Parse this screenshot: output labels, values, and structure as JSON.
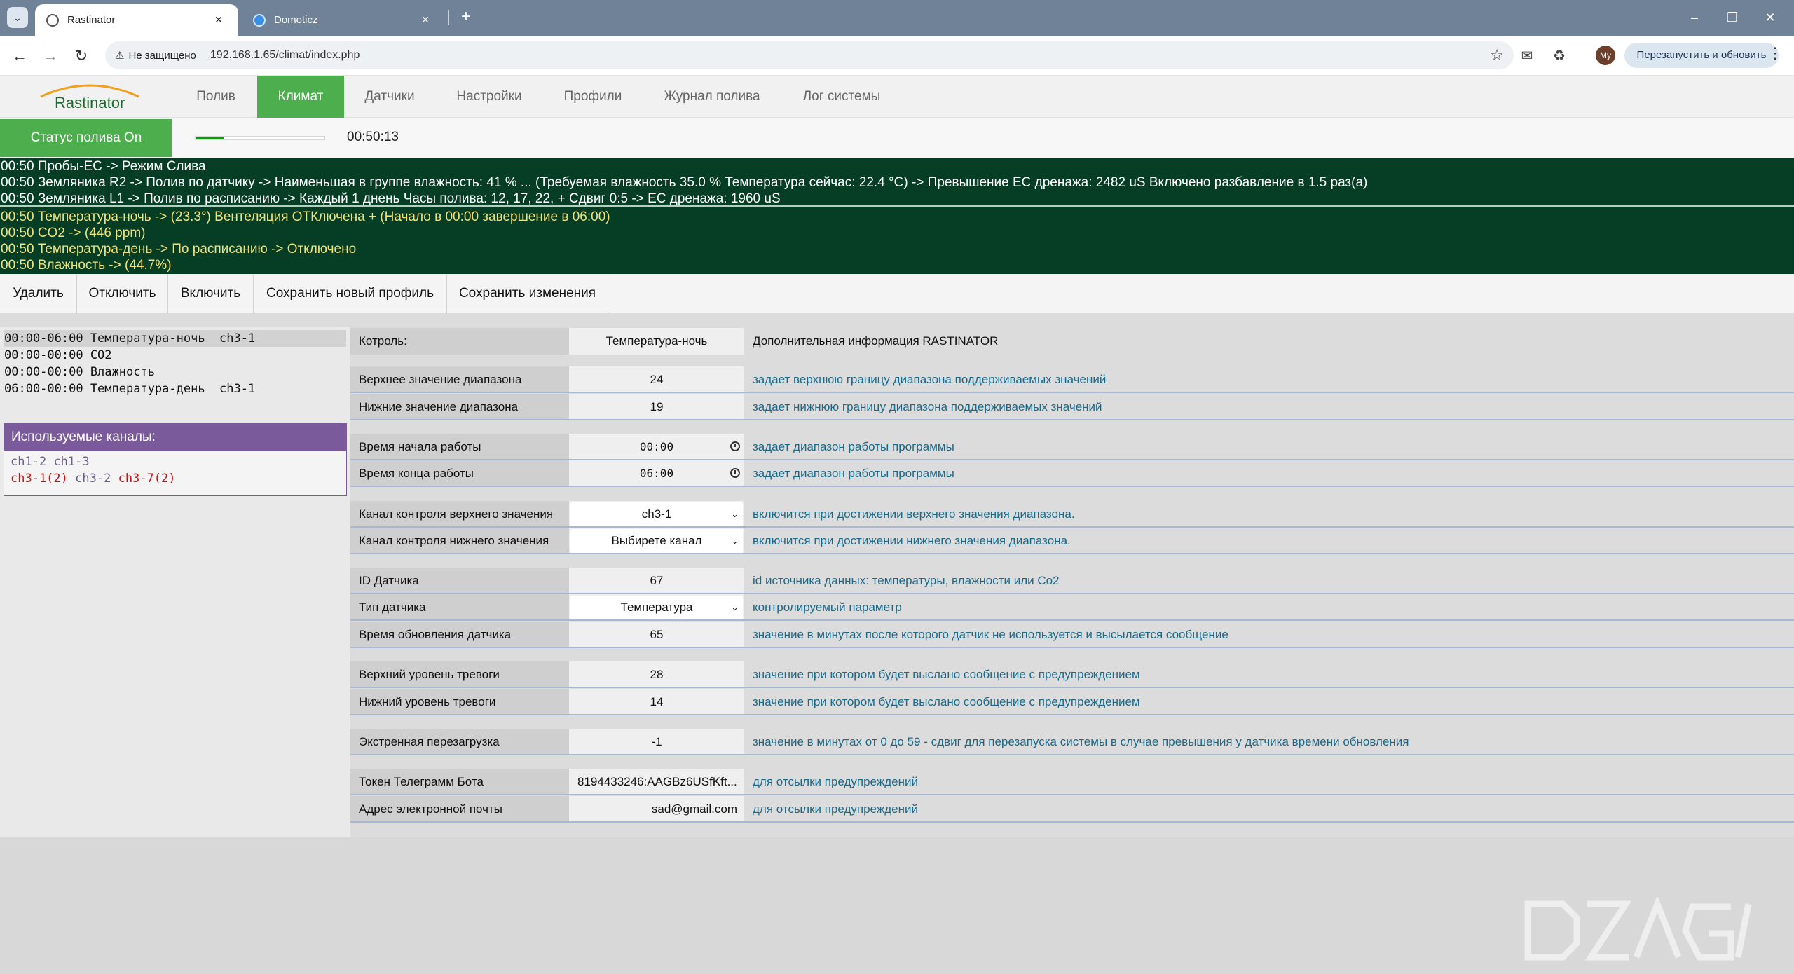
{
  "browser": {
    "tabs": [
      {
        "title": "Rastinator",
        "active": true
      },
      {
        "title": "Domoticz",
        "active": false
      }
    ],
    "address": {
      "security_label": "Не защищено",
      "url": "192.168.1.65/climat/index.php"
    },
    "avatar_initials": "My",
    "relaunch_label": "Перезапустить и обновить",
    "new_tab_symbol": "+"
  },
  "app": {
    "logo_text": "Rastinator",
    "nav": [
      {
        "label": "Полив",
        "active": false
      },
      {
        "label": "Климат",
        "active": true
      },
      {
        "label": "Датчики",
        "active": false
      },
      {
        "label": "Настройки",
        "active": false
      },
      {
        "label": "Профили",
        "active": false
      },
      {
        "label": "Журнал полива",
        "active": false
      },
      {
        "label": "Лог системы",
        "active": false
      }
    ],
    "accent_color": "#4cae4c",
    "status": {
      "label": "Статус полива On",
      "progress_percent": 22,
      "timer": "00:50:13"
    },
    "log": [
      {
        "text": "00:50 Пробы-EC -> Режим Слива",
        "color": "white"
      },
      {
        "text": "00:50 Земляника R2 -> Полив по датчику -> Наименьшая в группе влажность: 41 % ... (Требуемая влажность 35.0 % Температура сейчас: 22.4 °C) -> Превышение EC дренажа: 2482 uS Включено разбавление в 1.5 раз(а)",
        "color": "white"
      },
      {
        "text": "00:50 Земляника L1 -> Полив по расписанию -> Каждый 1 днень Часы полива: 12, 17, 22, + Сдвиг 0:5 -> EC дренажа: 1960 uS",
        "color": "white"
      },
      {
        "text": "00:50 Температура-ночь -> (23.3°) Вентеляция ОТКлючена + (Начало в 00:00 завершение в 06:00)",
        "color": "yellow"
      },
      {
        "text": "00:50 CO2 -> (446 ppm)",
        "color": "yellow"
      },
      {
        "text": "00:50 Температура-день -> По расписанию -> Отключено",
        "color": "yellow"
      },
      {
        "text": "00:50 Влажность -> (44.7%)",
        "color": "yellow"
      }
    ],
    "actions": [
      "Удалить",
      "Отключить",
      "Включить",
      "Сохранить новый профиль",
      "Сохранить изменения"
    ],
    "schedule": [
      {
        "text": "00:00-06:00 Температура-ночь  ch3-1",
        "selected": true
      },
      {
        "text": "00:00-00:00 CO2",
        "selected": false
      },
      {
        "text": "00:00-00:00 Влажность",
        "selected": false
      },
      {
        "text": "06:00-00:00 Температура-день  ch3-1",
        "selected": false
      }
    ],
    "channels": {
      "title": "Используемые каналы:",
      "line1": [
        {
          "text": "ch1-2",
          "color": "gray"
        },
        {
          "text": "ch1-3",
          "color": "gray"
        }
      ],
      "line2": [
        {
          "text": "ch3-1(2)",
          "color": "red"
        },
        {
          "text": "ch3-2",
          "color": "gray"
        },
        {
          "text": "ch3-7(2)",
          "color": "red"
        }
      ]
    },
    "form": {
      "header": {
        "label": "Котроль:",
        "value": "Температура-ночь",
        "info": "Дополнительная информация RASTINATOR"
      },
      "upper_value": {
        "label": "Верхнее значение диапазона",
        "value": "24",
        "info": "задает верхнюю границу диапазона поддерживаемых значений"
      },
      "lower_value": {
        "label": "Нижние значение диапазона",
        "value": "19",
        "info": "задает нижнюю границу диапазона поддерживаемых значений"
      },
      "start_time": {
        "label": "Время начала работы",
        "value": "00:00",
        "info": "задает диапазон работы программы"
      },
      "end_time": {
        "label": "Время конца работы",
        "value": "06:00",
        "info": "задает диапазон работы программы"
      },
      "upper_channel": {
        "label": "Канал контроля верхнего значения",
        "value": "ch3-1",
        "info": "включится при достижении верхнего значения диапазона."
      },
      "lower_channel": {
        "label": "Канал контроля нижнего значения",
        "value": "Выбирете канал",
        "info": "включится при достижении нижнего значения диапазона."
      },
      "sensor_id": {
        "label": "ID Датчика",
        "value": "67",
        "info": "id источника данных: температуры, влажности или Co2"
      },
      "sensor_type": {
        "label": "Тип датчика",
        "value": "Температура",
        "info": "контролируемый параметр"
      },
      "sensor_update": {
        "label": "Время обновления датчика",
        "value": "65",
        "info": "значение в минутах после которого датчик не используется и высылается сообщение"
      },
      "alarm_high": {
        "label": "Верхний уровень тревоги",
        "value": "28",
        "info": "значение при котором будет выслано сообщение с предупреждением"
      },
      "alarm_low": {
        "label": "Нижний уровень тревоги",
        "value": "14",
        "info": "значение при котором будет выслано сообщение с предупреждением"
      },
      "emergency_reboot": {
        "label": "Экстренная перезагрузка",
        "value": "-1",
        "info": "значение в минутах от 0 до 59 - сдвиг для перезапуска системы в случае превышения у датчика времени обновления"
      },
      "telegram_token": {
        "label": "Токен Телеграмм Бота",
        "value": "8194433246:AAGBz6USfKft...",
        "info": "для отсылки предупреждений"
      },
      "email": {
        "label": "Адрес электронной почты",
        "value": "sad@gmail.com",
        "info": "для отсылки предупреждений"
      }
    }
  }
}
